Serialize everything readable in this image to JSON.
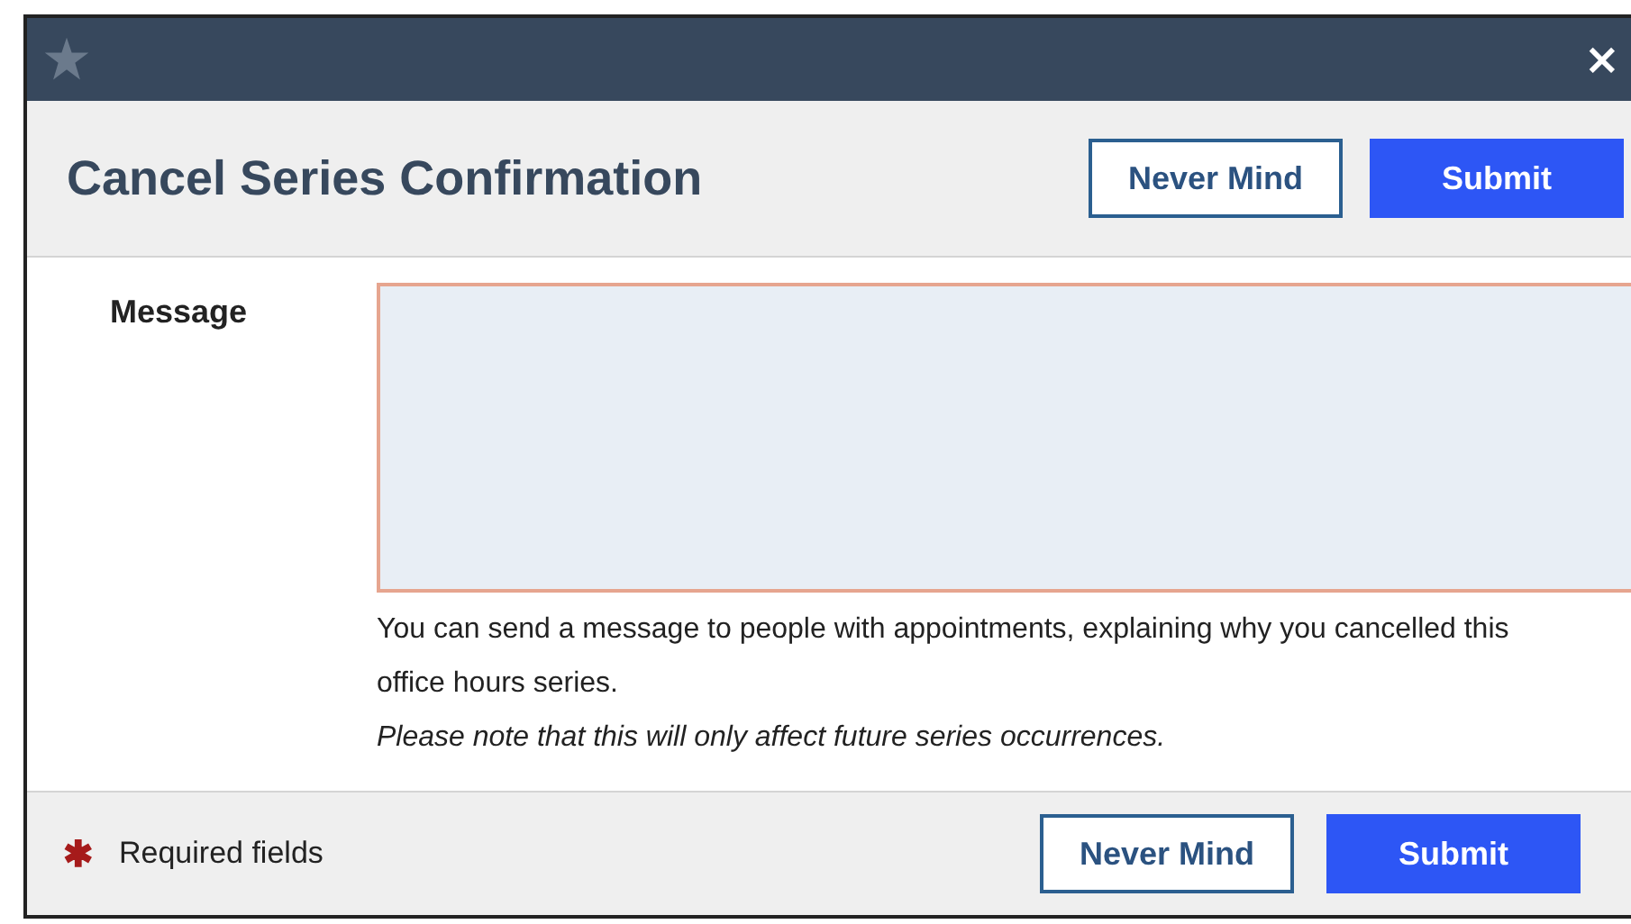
{
  "window": {
    "close": "×"
  },
  "header": {
    "title": "Cancel Series Confirmation",
    "buttons": [
      {
        "label": "Never Mind",
        "kind": "secondary"
      },
      {
        "label": "Submit",
        "kind": "primary"
      }
    ]
  },
  "form": {
    "label": "Message",
    "help": "You can send a message to people with appointments, explaining why you cancelled this office hours series.",
    "note": "Please note that this will only affect future series occurrences."
  },
  "footer": {
    "required_mark": "✱",
    "required_text": "Required fields",
    "buttons": [
      {
        "label": "Never Mind",
        "kind": "secondary"
      },
      {
        "label": "Submit",
        "kind": "primary"
      }
    ]
  }
}
